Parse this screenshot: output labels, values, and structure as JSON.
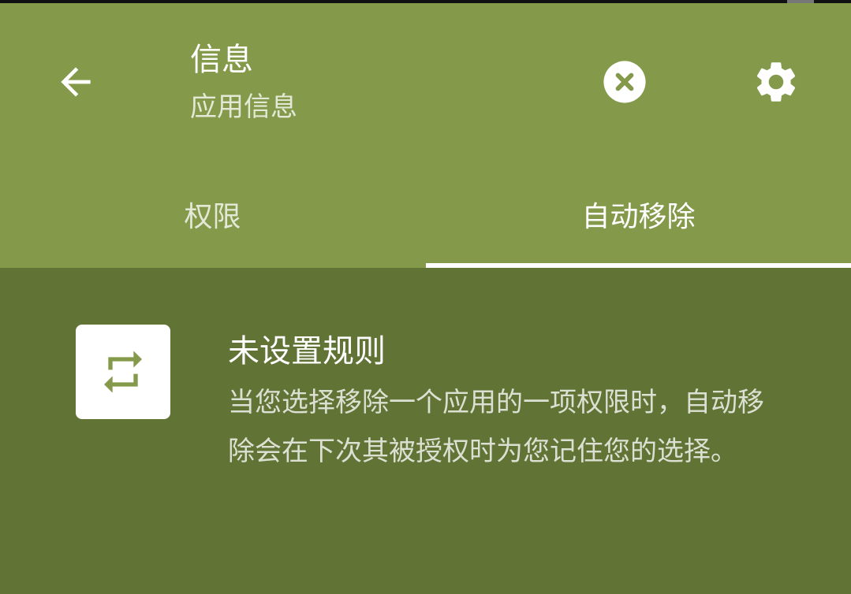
{
  "toolbar": {
    "title": "信息",
    "subtitle": "应用信息",
    "back_icon": "arrow-back-icon",
    "close_icon": "close-circle-icon",
    "settings_icon": "gear-icon"
  },
  "tabs": [
    {
      "label": "权限",
      "selected": false
    },
    {
      "label": "自动移除",
      "selected": true
    }
  ],
  "rule": {
    "icon": "repeat-icon",
    "title": "未设置规则",
    "description": "当您选择移除一个应用的一项权限时，自动移除会在下次其被授权时为您记住您的选择。"
  },
  "colors": {
    "header": "#849a4a",
    "content": "#617335",
    "accent": "#ffffff"
  }
}
